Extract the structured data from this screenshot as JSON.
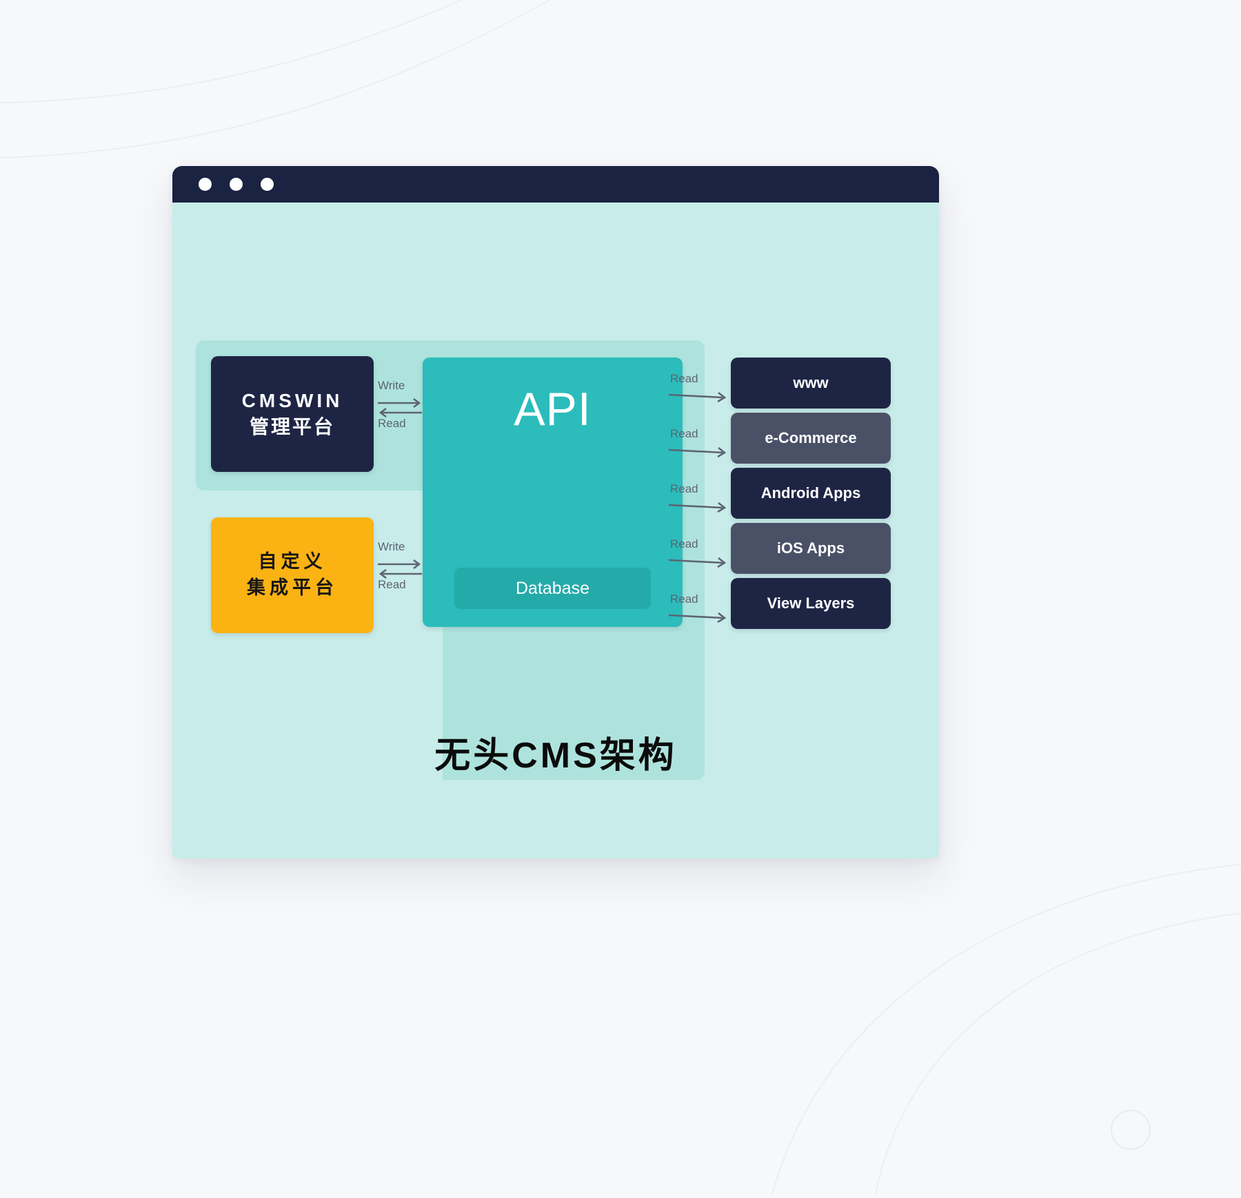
{
  "window": {
    "titlebar": {
      "dots": [
        "close-dot",
        "minimize-dot",
        "maximize-dot"
      ]
    }
  },
  "diagram": {
    "caption": "无头CMS架构",
    "left_column": [
      {
        "id": "cmswin",
        "line1": "CMSWIN",
        "line2": "管理平台",
        "color": "#1e2544"
      },
      {
        "id": "custom",
        "line1": "自定义",
        "line2": "集成平台",
        "color": "#fbb213"
      }
    ],
    "center": {
      "title": "API",
      "database_label": "Database",
      "color": "#2bbcbb",
      "database_color": "#25aaaa"
    },
    "right_column": [
      {
        "id": "www",
        "label": "www",
        "color": "#1e2544"
      },
      {
        "id": "ecommerce",
        "label": "e-Commerce",
        "color": "#4a5167"
      },
      {
        "id": "android",
        "label": "Android Apps",
        "color": "#1e2544"
      },
      {
        "id": "ios",
        "label": "iOS Apps",
        "color": "#4a5167"
      },
      {
        "id": "viewlayers",
        "label": "View Layers",
        "color": "#1e2544"
      }
    ],
    "connectors": {
      "write_label": "Write",
      "read_label": "Read",
      "left_pairs": [
        {
          "id": "cmswin",
          "top": "Write",
          "bottom": "Read"
        },
        {
          "id": "custom",
          "top": "Write",
          "bottom": "Read"
        }
      ],
      "right_reads": [
        {
          "id": "www",
          "label": "Read"
        },
        {
          "id": "ecommerce",
          "label": "Read"
        },
        {
          "id": "android",
          "label": "Read"
        },
        {
          "id": "ios",
          "label": "Read"
        },
        {
          "id": "viewlayers",
          "label": "Read"
        }
      ]
    }
  },
  "colors": {
    "page_background": "#f7f8fa",
    "titlebar": "#1b2342",
    "canvas": "#c8ece9",
    "panel": "#aee3dd",
    "accent_teal": "#2bbcbb",
    "accent_amber": "#fbb213",
    "dark_navy": "#1e2544",
    "slate": "#4a5167",
    "connector_text": "#5d6472"
  }
}
